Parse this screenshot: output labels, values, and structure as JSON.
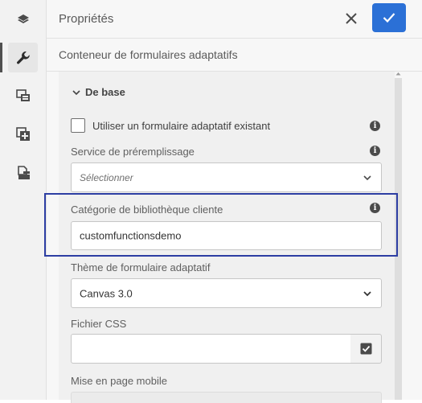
{
  "rail": {
    "items": [
      {
        "icon": "layers-icon",
        "active": false
      },
      {
        "icon": "wrench-icon",
        "active": true
      },
      {
        "icon": "assets-icon",
        "active": false
      },
      {
        "icon": "add-component-icon",
        "active": false
      },
      {
        "icon": "form-document-icon",
        "active": false
      }
    ]
  },
  "header": {
    "title": "Propriétés",
    "close_icon": "close-icon",
    "done_icon": "checkmark-icon",
    "done_color": "#2b70d6"
  },
  "subtitle": "Conteneur de formulaires adaptatifs",
  "section": {
    "title": "De base",
    "expanded": true
  },
  "fields": {
    "use_existing": {
      "label": "Utiliser un formulaire adaptatif existant",
      "checked": false
    },
    "prefill": {
      "label": "Service de préremplissage",
      "placeholder": "Sélectionner"
    },
    "client_lib": {
      "label": "Catégorie de bibliothèque cliente",
      "value": "customfunctionsdemo"
    },
    "theme": {
      "label": "Thème de formulaire adaptatif",
      "value": "Canvas 3.0"
    },
    "css_file": {
      "label": "Fichier CSS",
      "value": ""
    },
    "mobile_layout": {
      "label": "Mise en page mobile"
    }
  },
  "highlight_color": "#2d3ea3"
}
